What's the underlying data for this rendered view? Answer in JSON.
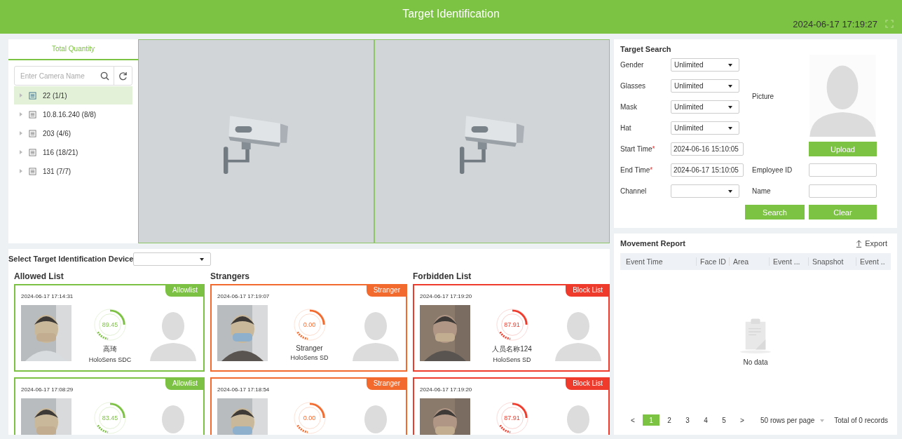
{
  "header": {
    "title": "Target Identification",
    "datetime": "2024-06-17 17:19:27"
  },
  "camera_tree": {
    "tab": "Total Quantity",
    "search": {
      "placeholder": "Enter Camera Name"
    },
    "items": [
      {
        "label": "22 (1/1)",
        "selected": true
      },
      {
        "label": "10.8.16.240 (8/8)",
        "selected": false
      },
      {
        "label": "203 (4/6)",
        "selected": false
      },
      {
        "label": "116 (18/21)",
        "selected": false
      },
      {
        "label": "131 (7/7)",
        "selected": false
      }
    ]
  },
  "device_select": {
    "label": "Select Target Identification Device"
  },
  "lists": [
    {
      "title": "Allowed List",
      "kind": "allow",
      "cards": [
        {
          "time": "2024-06-17 17:14:31",
          "tag": "Allowlist",
          "score": "89.45",
          "name": "高琦",
          "device": "HoloSens SDC"
        },
        {
          "time": "2024-06-17 17:08:29",
          "tag": "Allowlist",
          "score": "83.45"
        }
      ]
    },
    {
      "title": "Strangers",
      "kind": "stranger",
      "cards": [
        {
          "time": "2024-06-17 17:19:07",
          "tag": "Stranger",
          "score": "0.00",
          "name": "Stranger",
          "device": "HoloSens SD"
        },
        {
          "time": "2024-06-17 17:18:54",
          "tag": "Stranger",
          "score": "0.00"
        }
      ]
    },
    {
      "title": "Forbidden List",
      "kind": "block",
      "cards": [
        {
          "time": "2024-06-17 17:19:20",
          "tag": "Block List",
          "score": "87.91",
          "name": "人员名称124",
          "device": "HoloSens SD"
        },
        {
          "time": "2024-06-17 17:19:20",
          "tag": "Block List",
          "score": "87.91"
        }
      ]
    }
  ],
  "target_search": {
    "title": "Target Search",
    "fields": [
      {
        "label": "Gender",
        "kind": "select",
        "value": "Unlimited"
      },
      {
        "label": "Glasses",
        "kind": "select",
        "value": "Unlimited"
      },
      {
        "label": "Mask",
        "kind": "select",
        "value": "Unlimited"
      },
      {
        "label": "Hat",
        "kind": "select",
        "value": "Unlimited"
      },
      {
        "label": "Start Time",
        "mark": "*",
        "kind": "input",
        "value": "2024-06-16 15:10:05"
      },
      {
        "label": "End Time",
        "mark": "*",
        "kind": "input",
        "value": "2024-06-17 15:10:05"
      },
      {
        "label": "Channel",
        "kind": "select"
      }
    ],
    "picture_label": "Picture",
    "upload": "Upload",
    "employee_id_label": "Employee ID",
    "name_label": "Name",
    "search": "Search",
    "clear": "Clear"
  },
  "movement_report": {
    "title": "Movement Report",
    "export": "Export",
    "columns": [
      "Event Time",
      "Face ID",
      "Area",
      "Event ...",
      "Snapshot",
      "Event .."
    ],
    "empty": "No data",
    "pagination": {
      "prev": "<",
      "pages": [
        {
          "label": "1",
          "selected": true
        },
        {
          "label": "2",
          "selected": false
        },
        {
          "label": "3",
          "selected": false
        },
        {
          "label": "4",
          "selected": false
        },
        {
          "label": "5",
          "selected": false
        }
      ],
      "next": ">",
      "rows_per_page": "50 rows per page",
      "total": "Total of 0 records"
    }
  }
}
